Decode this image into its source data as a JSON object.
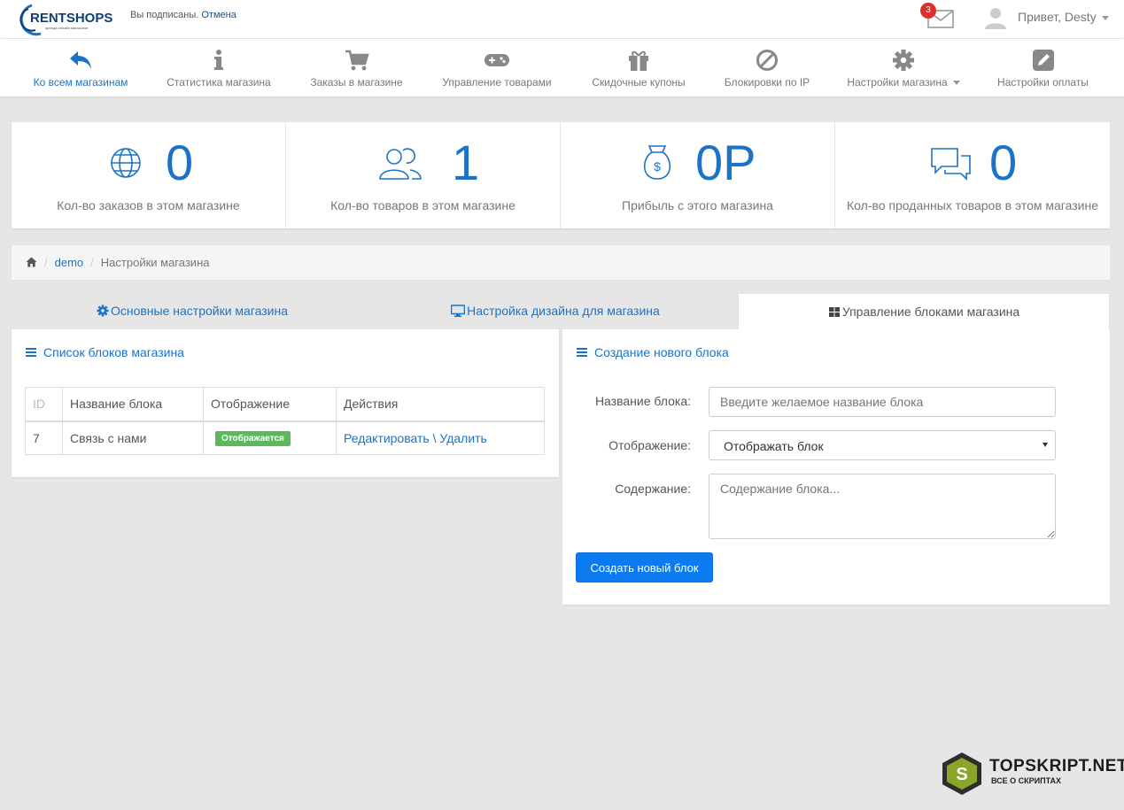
{
  "topbar": {
    "logo_text": "RENTSHOPS",
    "logo_tagline": "аренда онлайн магазинов",
    "subscribed_text": "Вы подписаны.",
    "cancel_link": "Отмена",
    "mail_count": "3",
    "greeting": "Привет, Desty"
  },
  "nav": [
    {
      "label": "Ко всем магазинам",
      "icon": "reply-icon"
    },
    {
      "label": "Статистика магазина",
      "icon": "info-icon"
    },
    {
      "label": "Заказы в магазине",
      "icon": "cart-icon"
    },
    {
      "label": "Управление товарами",
      "icon": "gamepad-icon"
    },
    {
      "label": "Скидочные купоны",
      "icon": "gift-icon"
    },
    {
      "label": "Блокировки по IP",
      "icon": "ban-icon"
    },
    {
      "label": "Настройки магазина",
      "icon": "gear-icon"
    },
    {
      "label": "Настройки оплаты",
      "icon": "edit-icon"
    }
  ],
  "stats": [
    {
      "value": "0",
      "label": "Кол-во заказов в этом магазине",
      "icon": "globe-icon"
    },
    {
      "value": "1",
      "label": "Кол-во товаров в этом магазине",
      "icon": "users-icon"
    },
    {
      "value": "0Р",
      "label": "Прибыль с этого магазина",
      "icon": "money-bag-icon"
    },
    {
      "value": "0",
      "label": "Кол-во проданных товаров в этом магазине",
      "icon": "chat-icon"
    }
  ],
  "breadcrumb": {
    "shop": "demo",
    "current": "Настройки магазина"
  },
  "tabs": [
    {
      "label": "Основные настройки магазина"
    },
    {
      "label": "Настройка дизайна для магазина"
    },
    {
      "label": "Управление блоками магазина"
    }
  ],
  "blocks_panel": {
    "title": "Список блоков магазина",
    "columns": [
      "ID",
      "Название блока",
      "Отображение",
      "Действия"
    ],
    "rows": [
      {
        "id": "7",
        "name": "Связь с нами",
        "status": "Отображается",
        "edit": "Редактировать",
        "sep": "\\",
        "delete": "Удалить"
      }
    ]
  },
  "create_panel": {
    "title": "Создание нового блока",
    "name_label": "Название блока:",
    "name_placeholder": "Введите желаемое название блока",
    "display_label": "Отображение:",
    "display_value": "Отображать блок",
    "content_label": "Содержание:",
    "content_placeholder": "Содержание блока...",
    "submit_label": "Создать новый блок"
  },
  "watermark": {
    "title": "TOPSKRIPT.NET",
    "subtitle": "ВСЕ О СКРИПТАХ",
    "badge_letter": "S"
  },
  "colors": {
    "accent": "#1a73c8",
    "primary_button": "#0d7bf0",
    "success": "#5cb85c",
    "badge": "#d9312b"
  }
}
